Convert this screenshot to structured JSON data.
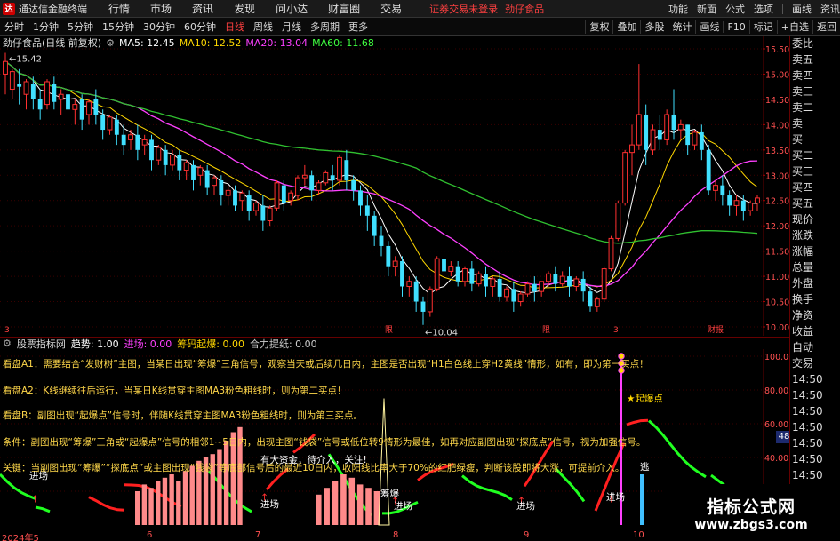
{
  "app": {
    "title": "通达信金融终端",
    "menu": [
      "行情",
      "市场",
      "资讯",
      "发现",
      "问小达",
      "财富圈",
      "交易"
    ],
    "warning": "证券交易未登录",
    "stock_short": "劲仔食品",
    "right_menu": [
      "功能",
      "新面",
      "公式",
      "选项",
      "画线",
      "资讯"
    ]
  },
  "toolbar": {
    "periods": [
      "分时",
      "1分钟",
      "5分钟",
      "15分钟",
      "30分钟",
      "60分钟",
      "日线",
      "周线",
      "月线",
      "多周期",
      "更多"
    ],
    "active_period": "日线",
    "tools": [
      "复权",
      "叠加",
      "多股",
      "统计",
      "画线",
      "F10",
      "标记",
      "+自选",
      "返回"
    ]
  },
  "main": {
    "stock_label": "劲仔食品(日线 前复权)",
    "ma": [
      {
        "label": "MA5: 12.45",
        "color": "#ffffff"
      },
      {
        "label": "MA10: 12.52",
        "color": "#ffd700"
      },
      {
        "label": "MA20: 13.04",
        "color": "#ff40ff"
      },
      {
        "label": "MA60: 11.68",
        "color": "#40ff40"
      }
    ],
    "high_label": "15.42",
    "low_label": "10.04",
    "price_ticks": [
      "15.50",
      "15.00",
      "14.50",
      "14.00",
      "13.50",
      "13.00",
      "12.50",
      "12.00",
      "11.50",
      "11.00",
      "10.50",
      "10.00"
    ],
    "markers": [
      {
        "x": 5,
        "text": "3"
      },
      {
        "x": 433,
        "text": "限"
      },
      {
        "x": 610,
        "text": "限"
      },
      {
        "x": 690,
        "text": "3"
      },
      {
        "x": 796,
        "text": "财报"
      }
    ]
  },
  "chart_data": {
    "type": "candlestick",
    "ylim": [
      10.0,
      15.5
    ],
    "candles": [
      [
        15.0,
        15.42,
        15.25,
        14.6
      ],
      [
        14.7,
        15.1,
        15.05,
        14.5
      ],
      [
        14.8,
        15.1,
        14.75,
        14.4
      ],
      [
        14.6,
        14.9,
        14.85,
        14.3
      ],
      [
        14.8,
        14.95,
        14.5,
        14.3
      ],
      [
        14.5,
        14.7,
        14.3,
        14.1
      ],
      [
        14.4,
        14.9,
        14.85,
        14.3
      ],
      [
        14.8,
        14.95,
        14.45,
        14.3
      ],
      [
        14.5,
        14.7,
        14.6,
        14.2
      ],
      [
        14.6,
        14.8,
        14.3,
        14.1
      ],
      [
        14.3,
        14.5,
        14.4,
        14.0
      ],
      [
        14.5,
        14.6,
        14.1,
        13.9
      ],
      [
        14.2,
        14.5,
        14.45,
        14.0
      ],
      [
        14.5,
        14.7,
        14.2,
        14.0
      ],
      [
        14.2,
        14.3,
        13.9,
        13.7
      ],
      [
        13.9,
        14.2,
        14.15,
        13.8
      ],
      [
        14.1,
        14.2,
        13.8,
        13.6
      ],
      [
        13.8,
        14.0,
        13.6,
        13.4
      ],
      [
        13.7,
        13.9,
        13.8,
        13.5
      ],
      [
        13.8,
        14.0,
        13.5,
        13.3
      ],
      [
        13.6,
        13.8,
        13.7,
        13.4
      ],
      [
        13.7,
        13.8,
        13.3,
        13.1
      ],
      [
        13.3,
        13.6,
        13.55,
        13.2
      ],
      [
        13.5,
        13.6,
        13.2,
        13.0
      ],
      [
        13.2,
        13.5,
        13.4,
        13.1
      ],
      [
        13.4,
        13.5,
        13.1,
        12.9
      ],
      [
        13.1,
        13.3,
        13.25,
        12.9
      ],
      [
        13.2,
        13.3,
        12.9,
        12.7
      ],
      [
        13.0,
        13.2,
        13.15,
        12.8
      ],
      [
        13.1,
        13.2,
        12.75,
        12.6
      ],
      [
        12.8,
        13.0,
        12.95,
        12.6
      ],
      [
        12.9,
        13.0,
        12.6,
        12.4
      ],
      [
        12.6,
        12.8,
        12.7,
        12.4
      ],
      [
        12.7,
        12.8,
        12.4,
        12.3
      ],
      [
        12.5,
        12.7,
        12.65,
        12.3
      ],
      [
        12.6,
        12.7,
        12.3,
        12.1
      ],
      [
        12.3,
        12.5,
        12.45,
        12.2
      ],
      [
        12.4,
        12.6,
        12.1,
        11.9
      ],
      [
        12.1,
        12.4,
        12.35,
        12.0
      ],
      [
        12.35,
        12.9,
        12.85,
        12.3
      ],
      [
        12.8,
        12.9,
        12.45,
        12.3
      ],
      [
        12.5,
        12.7,
        12.65,
        12.4
      ],
      [
        12.6,
        13.0,
        12.95,
        12.5
      ],
      [
        12.95,
        13.2,
        13.0,
        12.8
      ],
      [
        13.0,
        13.1,
        12.7,
        12.5
      ],
      [
        12.7,
        12.9,
        12.85,
        12.6
      ],
      [
        12.85,
        13.1,
        13.05,
        12.8
      ],
      [
        13.0,
        13.2,
        12.9,
        12.7
      ],
      [
        12.9,
        13.4,
        13.35,
        12.8
      ],
      [
        13.3,
        13.5,
        12.9,
        12.7
      ],
      [
        12.9,
        13.0,
        12.7,
        12.5
      ],
      [
        12.7,
        12.8,
        12.4,
        12.2
      ],
      [
        12.4,
        12.6,
        12.2,
        11.9
      ],
      [
        12.2,
        12.3,
        11.8,
        11.6
      ],
      [
        11.8,
        12.0,
        11.6,
        11.4
      ],
      [
        11.6,
        11.7,
        11.2,
        11.0
      ],
      [
        11.2,
        11.4,
        11.3,
        11.0
      ],
      [
        11.3,
        11.4,
        10.8,
        10.6
      ],
      [
        10.8,
        11.0,
        10.9,
        10.6
      ],
      [
        10.9,
        11.0,
        10.5,
        10.3
      ],
      [
        10.5,
        10.6,
        10.3,
        10.04
      ],
      [
        10.3,
        10.8,
        10.75,
        10.2
      ],
      [
        10.75,
        11.4,
        11.35,
        10.7
      ],
      [
        11.35,
        11.6,
        11.1,
        10.9
      ],
      [
        11.1,
        11.3,
        11.2,
        11.0
      ],
      [
        11.2,
        11.3,
        10.9,
        10.8
      ],
      [
        10.9,
        11.2,
        11.15,
        10.8
      ],
      [
        11.15,
        11.3,
        10.85,
        10.7
      ],
      [
        10.85,
        11.1,
        11.05,
        10.8
      ],
      [
        11.05,
        11.2,
        10.8,
        10.6
      ],
      [
        10.8,
        11.0,
        10.95,
        10.6
      ],
      [
        10.95,
        11.1,
        10.6,
        10.5
      ],
      [
        10.6,
        10.8,
        10.75,
        10.5
      ],
      [
        10.75,
        10.9,
        10.5,
        10.3
      ],
      [
        10.5,
        10.7,
        10.65,
        10.4
      ],
      [
        10.65,
        10.9,
        10.85,
        10.6
      ],
      [
        10.85,
        11.0,
        10.7,
        10.5
      ],
      [
        10.7,
        10.9,
        10.9,
        10.6
      ],
      [
        10.9,
        11.1,
        11.05,
        10.8
      ],
      [
        11.05,
        11.2,
        10.85,
        10.7
      ],
      [
        10.85,
        11.1,
        11.0,
        10.8
      ],
      [
        11.0,
        11.2,
        10.8,
        10.6
      ],
      [
        10.8,
        11.0,
        10.95,
        10.7
      ],
      [
        10.95,
        11.1,
        10.7,
        10.5
      ],
      [
        10.7,
        10.8,
        10.4,
        10.3
      ],
      [
        10.4,
        10.6,
        10.55,
        10.3
      ],
      [
        10.55,
        11.2,
        11.15,
        10.5
      ],
      [
        11.15,
        11.8,
        11.75,
        11.1
      ],
      [
        11.75,
        12.5,
        12.45,
        11.7
      ],
      [
        12.45,
        13.5,
        13.45,
        12.4
      ],
      [
        13.45,
        14.0,
        13.6,
        13.0
      ],
      [
        13.6,
        15.2,
        14.2,
        13.5
      ],
      [
        14.2,
        14.4,
        13.5,
        13.2
      ],
      [
        13.5,
        14.0,
        13.9,
        13.4
      ],
      [
        13.9,
        14.2,
        13.7,
        13.5
      ],
      [
        13.7,
        14.3,
        14.2,
        13.6
      ],
      [
        14.2,
        14.7,
        13.9,
        13.7
      ],
      [
        13.9,
        14.1,
        14.0,
        13.7
      ],
      [
        14.0,
        14.0,
        13.6,
        13.4
      ],
      [
        13.6,
        13.9,
        13.85,
        13.5
      ],
      [
        13.85,
        14.0,
        13.5,
        13.3
      ],
      [
        13.5,
        13.6,
        12.7,
        12.6
      ],
      [
        12.7,
        12.9,
        12.8,
        12.5
      ],
      [
        12.8,
        13.0,
        12.6,
        12.4
      ],
      [
        12.6,
        12.7,
        12.4,
        12.2
      ],
      [
        12.4,
        12.6,
        12.5,
        12.2
      ],
      [
        12.5,
        12.6,
        12.3,
        12.1
      ],
      [
        12.3,
        12.5,
        12.45,
        12.2
      ],
      [
        12.45,
        12.6,
        12.55,
        12.3
      ]
    ]
  },
  "indicator": {
    "name": "股票指标网",
    "values": [
      {
        "label": "趋势: 1.00",
        "color": "#ffffff"
      },
      {
        "label": "进场: 0.00",
        "color": "#ff40ff"
      },
      {
        "label": "筹码起爆: 0.00",
        "color": "#ffd700"
      },
      {
        "label": "合力提纸: 0.00",
        "color": "#cccccc"
      }
    ],
    "axis_ticks": [
      "100.00",
      "80.00",
      "60.00",
      "40.00",
      "20.00"
    ],
    "float_value": "48.06",
    "texts": [
      {
        "x": 3,
        "y": 402,
        "text": "看盘A1：需要结合“发财树”主图，当某日出现“筹爆”三角信号，观察当天或后续几日内，主图是否出现“H1白色线上穿H2黄线”情形，如有，即为第一买点！"
      },
      {
        "x": 3,
        "y": 432,
        "text": "看盘A2：K线继续往后运行，当某日K线贯穿主图MA3粉色粗线时，则为第二买点！"
      },
      {
        "x": 3,
        "y": 460,
        "text": "看盘B：副图出现“起爆点”信号时，伴随K线贯穿主图MA3粉色粗线时，则为第三买点。"
      },
      {
        "x": 3,
        "y": 490,
        "text": "条件：副图出现“筹爆”三角或“起爆点”信号的相邻1~5日内，出现主图“钱袋”信号或低位转9情形为最佳，如再对应副图出现“探底点”信号，视为加强信号。"
      },
      {
        "x": 3,
        "y": 519,
        "text": "关键：当副图出现“筹爆”“探底点”或主图出现“钱袋”等底部信号后的最近10日内，收阳线比率大于70%的红肥绿瘦，判断该股即将大涨，可提前介入。"
      }
    ],
    "labels": [
      {
        "x": 33,
        "y": 528,
        "text": "进场",
        "color": "#ffffff"
      },
      {
        "x": 293,
        "y": 510,
        "text": "有大资金，待介入，关注!",
        "color": "#ffffff"
      },
      {
        "x": 293,
        "y": 560,
        "text": "进场",
        "color": "#ffffff"
      },
      {
        "x": 428,
        "y": 548,
        "text": "筹爆",
        "color": "#ffffff"
      },
      {
        "x": 443,
        "y": 562,
        "text": "进场",
        "color": "#ffffff"
      },
      {
        "x": 581,
        "y": 562,
        "text": "进场",
        "color": "#ffffff"
      },
      {
        "x": 682,
        "y": 552,
        "text": "进场",
        "color": "#ffffff"
      },
      {
        "x": 705,
        "y": 441,
        "text": "★起爆点",
        "color": "#ffd700"
      },
      {
        "x": 720,
        "y": 518,
        "text": "逃",
        "color": "#ffffff"
      }
    ]
  },
  "dates": [
    {
      "x": 2,
      "text": "2024年5"
    },
    {
      "x": 165,
      "text": "6"
    },
    {
      "x": 287,
      "text": "7"
    },
    {
      "x": 442,
      "text": "8"
    },
    {
      "x": 589,
      "text": "9"
    },
    {
      "x": 712,
      "text": "10"
    }
  ],
  "side_items": [
    "委比",
    "卖五",
    "卖四",
    "卖三",
    "卖二",
    "卖一",
    "买一",
    "买二",
    "买三",
    "买四",
    "买五",
    "现价",
    "涨跌",
    "涨幅",
    "总量",
    "外盘",
    "换手",
    "净资",
    "收益",
    "自动",
    "交易",
    "14:50",
    "14:50",
    "14:50",
    "14:50",
    "14:50",
    "14:50",
    "14:50",
    "14:50"
  ],
  "watermark": {
    "line1": "指标公式网",
    "line2": "www.zbgs3.com"
  }
}
